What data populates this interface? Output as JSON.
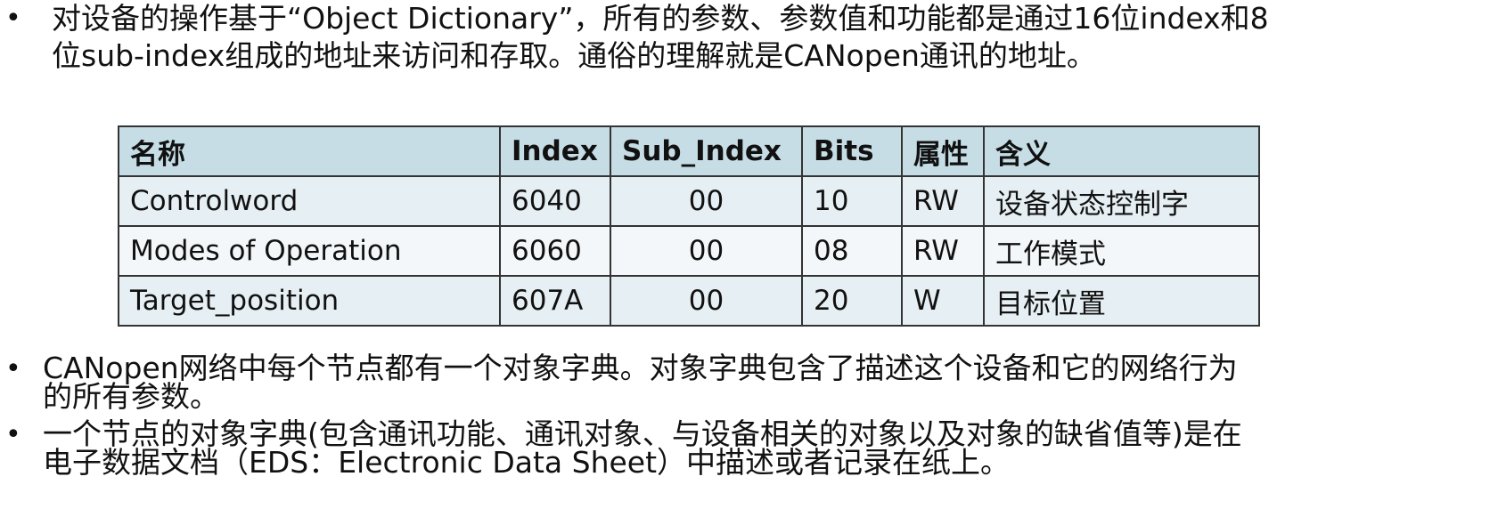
{
  "intro": {
    "bullet": "•",
    "line1": "对设备的操作基于“Object Dictionary”，所有的参数、参数值和功能都是通过16位index和8",
    "line2": "位sub-index组成的地址来访问和存取。通俗的理解就是CANopen通讯的地址。"
  },
  "table": {
    "headers": [
      "名称",
      "Index",
      "Sub_Index",
      "Bits",
      "属性",
      "含义"
    ],
    "rows": [
      [
        "Controlword",
        "6040",
        "00",
        "10",
        "RW",
        "设备状态控制字"
      ],
      [
        "Modes of Operation",
        "6060",
        "00",
        "08",
        "RW",
        "工作模式"
      ],
      [
        "Target_position",
        "607A",
        "00",
        "20",
        "W",
        "目标位置"
      ]
    ]
  },
  "notes": [
    {
      "bullet": "•",
      "line1": "CANopen网络中每个节点都有一个对象字典。对象字典包含了描述这个设备和它的网络行为",
      "line2": "的所有参数。"
    },
    {
      "bullet": "•",
      "line1": "一个节点的对象字典(包含通讯功能、通讯对象、与设备相关的对象以及对象的缺省值等)是在",
      "line2": "电子数据文档（EDS：Electronic Data Sheet）中描述或者记录在纸上。"
    }
  ],
  "colors": {
    "header_bg": "#c6dde6",
    "row_bg_a": "#e6eff3",
    "row_bg_b": "#f3f7f9",
    "border": "#333333"
  }
}
